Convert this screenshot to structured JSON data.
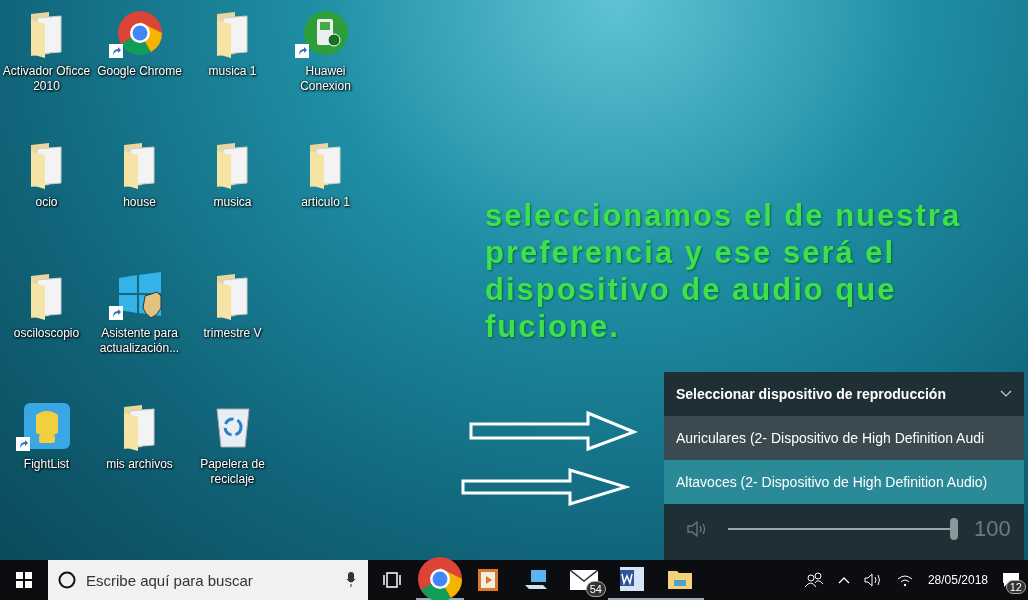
{
  "desktop": {
    "icons": [
      {
        "label": "Activador Oficce 2010",
        "kind": "folder",
        "shortcut": false
      },
      {
        "label": "Google Chrome",
        "kind": "chrome",
        "shortcut": true
      },
      {
        "label": "musica 1",
        "kind": "folder",
        "shortcut": false
      },
      {
        "label": "Huawei Conexion",
        "kind": "green-app",
        "shortcut": true
      },
      {
        "label": "ocio",
        "kind": "folder",
        "shortcut": false
      },
      {
        "label": "house",
        "kind": "folder",
        "shortcut": false
      },
      {
        "label": "musica",
        "kind": "folder",
        "shortcut": false
      },
      {
        "label": "articulo 1",
        "kind": "folder",
        "shortcut": false
      },
      {
        "label": "osciloscopio",
        "kind": "folder",
        "shortcut": false
      },
      {
        "label": "Asistente para actualización...",
        "kind": "windows",
        "shortcut": true
      },
      {
        "label": "trimestre V",
        "kind": "folder",
        "shortcut": false
      },
      {
        "label": "FightList",
        "kind": "glove-app",
        "shortcut": true
      },
      {
        "label": "mis archivos",
        "kind": "folder",
        "shortcut": false
      },
      {
        "label": "Papelera de reciclaje",
        "kind": "recycle-bin",
        "shortcut": false
      }
    ]
  },
  "annotation": {
    "text": "seleccionamos el de nuestra preferencia y ese será el dispositivo de audio que fucione."
  },
  "flyout": {
    "title": "Seleccionar dispositivo de reproducción",
    "devices": [
      {
        "name": "Auriculares (2- Dispositivo de High Definition Audi",
        "selected": false
      },
      {
        "name": "Altavoces (2- Dispositivo de High Definition Audio)",
        "selected": true
      }
    ],
    "volume": {
      "level": 1,
      "reading": "100"
    }
  },
  "taskbar": {
    "search": {
      "placeholder": "Escribe aquí para buscar"
    },
    "apps": [
      {
        "kind": "task-view",
        "running": false
      },
      {
        "kind": "chrome",
        "running": true
      },
      {
        "kind": "media",
        "running": false
      },
      {
        "kind": "computer",
        "running": false
      },
      {
        "kind": "mail",
        "running": false,
        "badge": "54"
      },
      {
        "kind": "word",
        "running": true
      },
      {
        "kind": "explorer",
        "running": true
      }
    ],
    "tray": {
      "date": "28/05/2018",
      "notifications": "12"
    }
  }
}
